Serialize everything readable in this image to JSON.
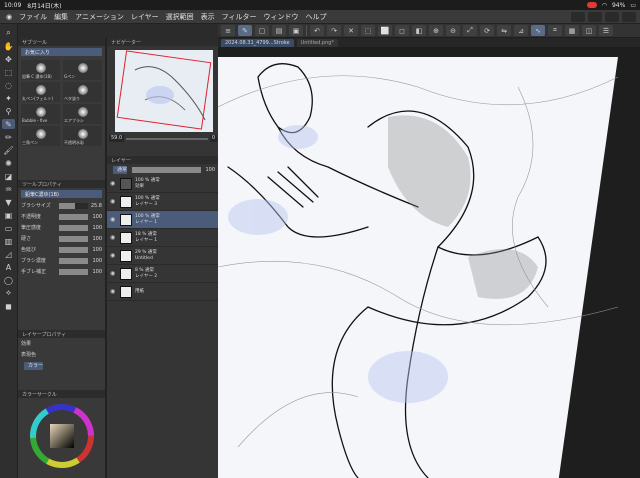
{
  "status": {
    "time": "10:09",
    "date": "8月14日(木)",
    "battery": "94%"
  },
  "menu": [
    "ファイル",
    "編集",
    "アニメーション",
    "レイヤー",
    "選択範囲",
    "表示",
    "フィルター",
    "ウィンドウ",
    "ヘルプ"
  ],
  "tabs": [
    {
      "label": "2024.08.31_4799...Stroke",
      "active": true
    },
    {
      "label": "Untitled.png*",
      "active": false
    }
  ],
  "subtool": {
    "header": "サブツール",
    "active_group": "お気に入り",
    "brushes": [
      {
        "label": "鉛筆 C 濃ゆ(1B)"
      },
      {
        "label": "Gペン"
      },
      {
        "label": "丸ペン(フェルト)"
      },
      {
        "label": "ベタ塗り"
      },
      {
        "label": "Bubble・five"
      },
      {
        "label": "エアブラシ"
      },
      {
        "label": "三角ペン"
      },
      {
        "label": "不透明水彩"
      }
    ]
  },
  "navigator": {
    "header": "ナビゲーター",
    "zoom": "59.0",
    "angle": "0"
  },
  "toolprop": {
    "header": "ツールプロパティ",
    "tool_name": "鉛筆C濃ゆ(1B)",
    "rows": [
      {
        "name": "ブラシサイズ",
        "value": "25.8",
        "fill": 0.55
      },
      {
        "name": "不透明度",
        "value": "100",
        "fill": 1.0
      },
      {
        "name": "筆圧感度",
        "value": "100",
        "fill": 1.0
      },
      {
        "name": "硬さ",
        "value": "100",
        "fill": 1.0
      },
      {
        "name": "色延び",
        "value": "100",
        "fill": 1.0
      },
      {
        "name": "ブラシ濃度",
        "value": "100",
        "fill": 1.0
      },
      {
        "name": "手ブレ補正",
        "value": "100",
        "fill": 1.0
      }
    ]
  },
  "layerprop": {
    "header": "レイヤープロパティ",
    "effect": "効果",
    "expression": "表現色",
    "color": "カラー"
  },
  "colorwheel": {
    "header": "カラーサークル"
  },
  "layers": {
    "header": "レイヤー",
    "blend": "通常",
    "opacity": "100",
    "rows": [
      {
        "pct": "100 %",
        "mode": "通常",
        "name": "効果",
        "thumb": "folder",
        "selected": false
      },
      {
        "pct": "100 %",
        "mode": "通常",
        "name": "レイヤー 3",
        "thumb": "blank",
        "selected": false
      },
      {
        "pct": "100 %",
        "mode": "通常",
        "name": "レイヤー 1",
        "thumb": "blank",
        "selected": true
      },
      {
        "pct": "18 %",
        "mode": "通常",
        "name": "レイヤー 1",
        "thumb": "blank",
        "selected": false
      },
      {
        "pct": "29 %",
        "mode": "通常",
        "name": "Untitled",
        "thumb": "image",
        "selected": false
      },
      {
        "pct": "8 %",
        "mode": "通常",
        "name": "レイヤー 2",
        "thumb": "blank",
        "selected": false
      },
      {
        "pct": "",
        "mode": "",
        "name": "用紙",
        "thumb": "paper",
        "selected": false
      }
    ]
  },
  "colors": {
    "accent": "#4b5b7a",
    "canvas_bg": "#1e1e1e",
    "highlight": "#b8c4ef"
  }
}
